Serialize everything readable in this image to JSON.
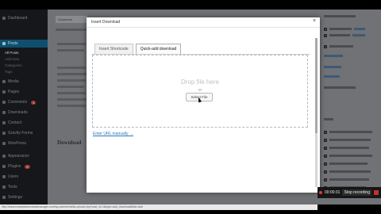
{
  "modal": {
    "title": "Insert Download",
    "close": "×",
    "tabs": [
      {
        "label": "Insert Shortcode",
        "active": false
      },
      {
        "label": "Quick-add download",
        "active": true
      }
    ],
    "drop_text": "Drop file here",
    "or_text": "or",
    "select_label": "Select File",
    "manual_link": "Enter URL manually →"
  },
  "sidebar": {
    "items": [
      {
        "label": "Dashboard",
        "icon": "dashboard-icon"
      },
      {
        "label": "Posts",
        "icon": "pin-icon",
        "active": true
      },
      {
        "label": "Media",
        "icon": "media-icon"
      },
      {
        "label": "Pages",
        "icon": "page-icon"
      },
      {
        "label": "Comments",
        "icon": "comment-icon",
        "badge": "1"
      },
      {
        "label": "Downloads",
        "icon": "download-icon"
      },
      {
        "label": "Contact",
        "icon": "mail-icon"
      },
      {
        "label": "Gravity Forms",
        "icon": "form-icon"
      },
      {
        "label": "WooPress",
        "icon": "cart-icon"
      },
      {
        "label": "Appearance",
        "icon": "brush-icon"
      },
      {
        "label": "Plugins",
        "icon": "plugin-icon",
        "badge": "5"
      },
      {
        "label": "Users",
        "icon": "user-icon"
      },
      {
        "label": "Tools",
        "icon": "wrench-icon"
      },
      {
        "label": "Settings",
        "icon": "gear-icon"
      }
    ],
    "subitems": [
      "All Posts",
      "Add New",
      "Categories",
      "Tags"
    ]
  },
  "editor": {
    "tab": "Download",
    "heading": "Download"
  },
  "recorder": {
    "time": "00:00:31",
    "stop_label": "Stop recording"
  },
  "statusbar": {
    "url": "http://www.exampledownloadmanager.com/wp-admin/media-upload.php?post_id=1&type=add_download&tab=add"
  },
  "colors": {
    "accent": "#2a77b8",
    "sidebar_bg": "#15171a",
    "active_menu": "#0f4f6e",
    "record": "#d83a3a"
  }
}
